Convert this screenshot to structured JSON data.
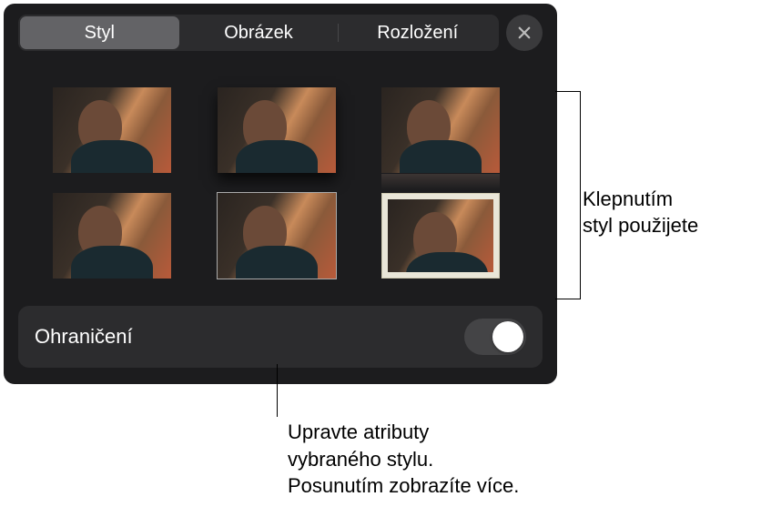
{
  "tabs": {
    "style": "Styl",
    "image": "Obrázek",
    "layout": "Rozložení",
    "active": "style"
  },
  "styles": [
    {
      "id": "plain",
      "effect": ""
    },
    {
      "id": "shadow",
      "effect": "shadow"
    },
    {
      "id": "reflect",
      "effect": "reflect"
    },
    {
      "id": "plain2",
      "effect": ""
    },
    {
      "id": "line",
      "effect": "line"
    },
    {
      "id": "frame",
      "effect": "frame"
    }
  ],
  "option": {
    "border_label": "Ohraničení",
    "border_on": false
  },
  "callout_right": {
    "line1": "Klepnutím",
    "line2": "styl použijete"
  },
  "callout_bottom": {
    "line1": "Upravte atributy",
    "line2": "vybraného stylu.",
    "line3": "Posunutím zobrazíte více."
  }
}
